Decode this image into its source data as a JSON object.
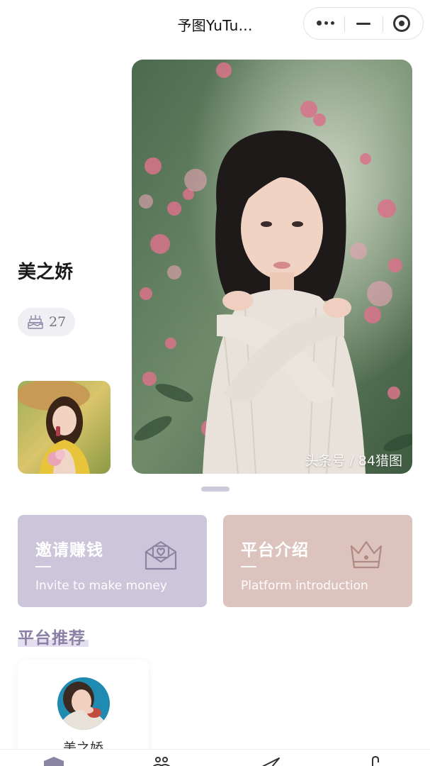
{
  "app": {
    "title": "予图YuTu..."
  },
  "capsule": {
    "more": "more-icon",
    "minimize": "minimize-icon",
    "close": "close-icon"
  },
  "hero": {
    "name": "美之娇",
    "likes": "27",
    "photo_credit": "头条号 / 84猎图"
  },
  "cards": [
    {
      "title": "邀请赚钱",
      "subtitle": "Invite to make money",
      "icon": "envelope-heart-icon",
      "color": "#cdc6da"
    },
    {
      "title": "平台介绍",
      "subtitle": "Platform introduction",
      "icon": "crown-icon",
      "color": "#dcc3bd"
    }
  ],
  "section": {
    "title": "平台推荐"
  },
  "recommend": [
    {
      "name": "美之娇"
    }
  ],
  "tabbar": {
    "icons": [
      "home-icon",
      "people-icon",
      "send-icon",
      "profile-icon"
    ]
  }
}
